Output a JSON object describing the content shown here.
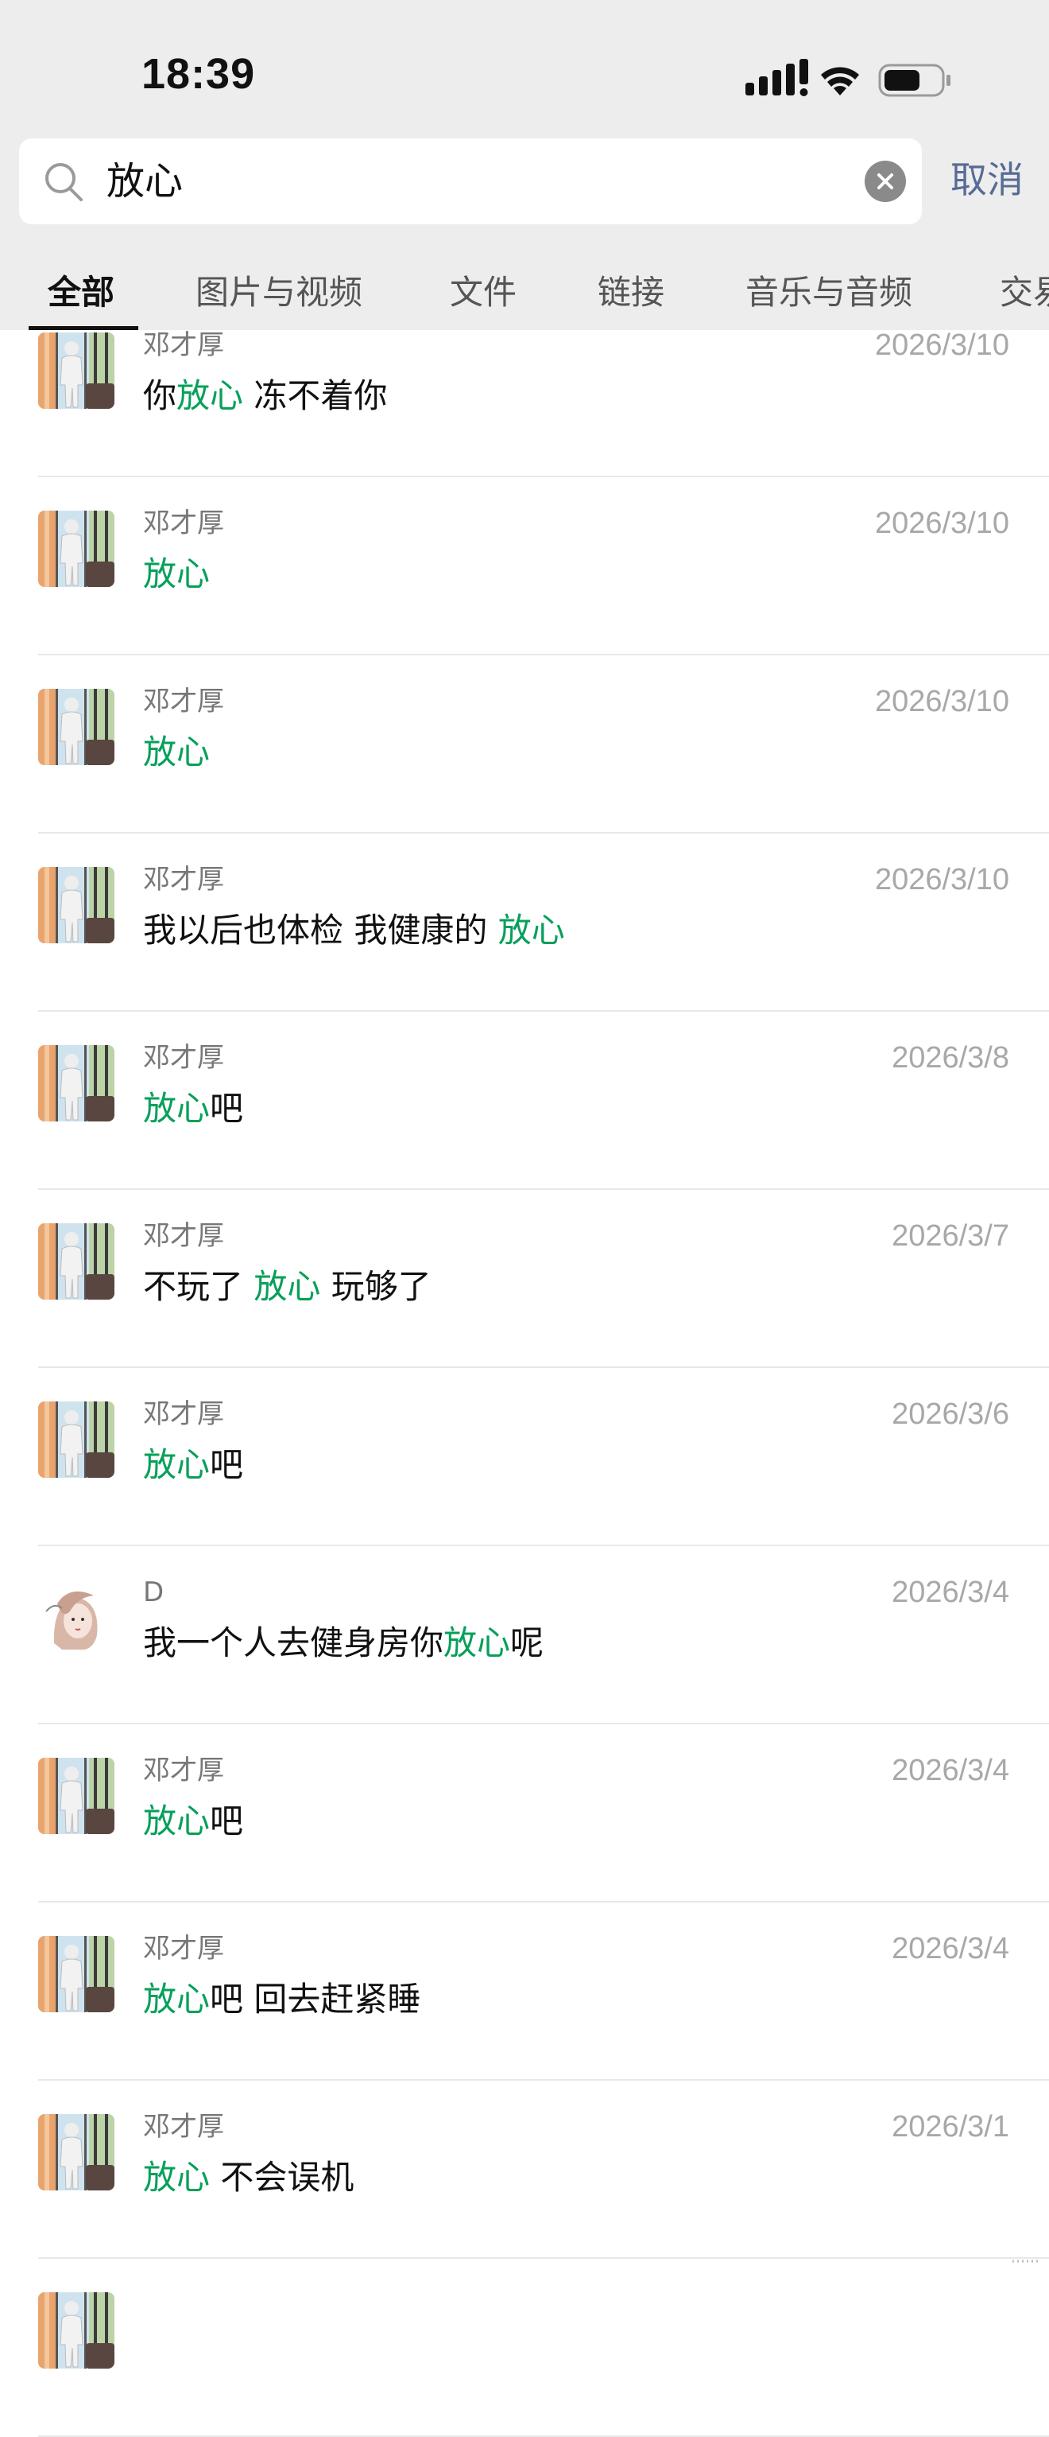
{
  "status_bar": {
    "time": "18:39"
  },
  "search": {
    "query": "放心",
    "cancel_label": "取消"
  },
  "tabs": [
    {
      "label": "全部",
      "active": true
    },
    {
      "label": "图片与视频"
    },
    {
      "label": "文件"
    },
    {
      "label": "链接"
    },
    {
      "label": "音乐与音频"
    },
    {
      "label": "交易"
    }
  ],
  "colors": {
    "highlight": "#07a05a",
    "link": "#576b95",
    "header_bg": "#ededed"
  },
  "results": [
    {
      "name": "邓才厚",
      "date": "2026/3/10",
      "avatar": "person-window",
      "parts": [
        [
          "你",
          0
        ],
        [
          "放心",
          1
        ],
        [
          " 冻不着你",
          0
        ]
      ]
    },
    {
      "name": "邓才厚",
      "date": "2026/3/10",
      "avatar": "person-window",
      "parts": [
        [
          "放心",
          1
        ]
      ]
    },
    {
      "name": "邓才厚",
      "date": "2026/3/10",
      "avatar": "person-window",
      "parts": [
        [
          "放心",
          1
        ]
      ]
    },
    {
      "name": "邓才厚",
      "date": "2026/3/10",
      "avatar": "person-window",
      "parts": [
        [
          "我以后也体检 我健康的 ",
          0
        ],
        [
          "放心",
          1
        ]
      ]
    },
    {
      "name": "邓才厚",
      "date": "2026/3/8",
      "avatar": "person-window",
      "parts": [
        [
          "放心",
          1
        ],
        [
          "吧",
          0
        ]
      ]
    },
    {
      "name": "邓才厚",
      "date": "2026/3/7",
      "avatar": "person-window",
      "parts": [
        [
          "不玩了 ",
          0
        ],
        [
          "放心",
          1
        ],
        [
          " 玩够了",
          0
        ]
      ]
    },
    {
      "name": "邓才厚",
      "date": "2026/3/6",
      "avatar": "person-window",
      "parts": [
        [
          "放心",
          1
        ],
        [
          "吧",
          0
        ]
      ]
    },
    {
      "name": "D",
      "date": "2026/3/4",
      "avatar": "girl-illustration",
      "parts": [
        [
          "我一个人去健身房你",
          0
        ],
        [
          "放心",
          1
        ],
        [
          "呢",
          0
        ]
      ]
    },
    {
      "name": "邓才厚",
      "date": "2026/3/4",
      "avatar": "person-window",
      "parts": [
        [
          "放心",
          1
        ],
        [
          "吧",
          0
        ]
      ]
    },
    {
      "name": "邓才厚",
      "date": "2026/3/4",
      "avatar": "person-window",
      "parts": [
        [
          "放心",
          1
        ],
        [
          "吧 回去赶紧睡",
          0
        ]
      ]
    },
    {
      "name": "邓才厚",
      "date": "2026/3/1",
      "avatar": "person-window",
      "parts": [
        [
          "放心",
          1
        ],
        [
          " 不会误机",
          0
        ]
      ]
    },
    {
      "name": "",
      "date": "",
      "avatar": "person-window",
      "parts": []
    }
  ]
}
